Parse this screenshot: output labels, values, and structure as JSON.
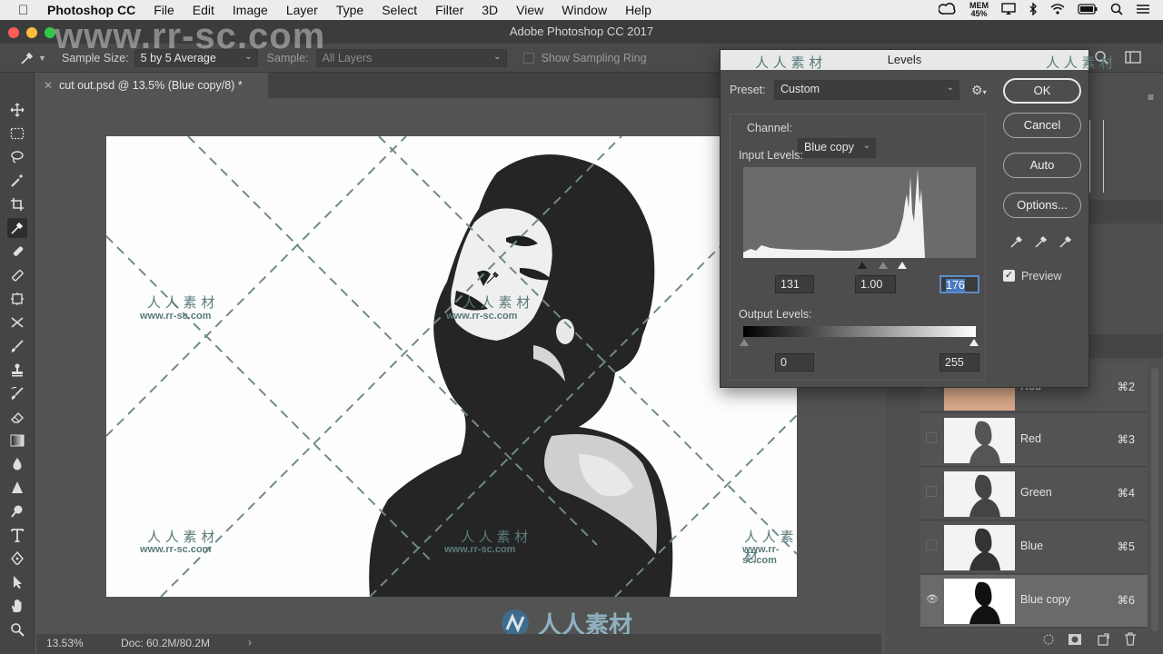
{
  "menubar": {
    "app_name": "Photoshop CC",
    "items": [
      "File",
      "Edit",
      "Image",
      "Layer",
      "Type",
      "Select",
      "Filter",
      "3D",
      "View",
      "Window",
      "Help"
    ],
    "mem_label": "MEM",
    "mem_value": "45%"
  },
  "window": {
    "title": "Adobe Photoshop CC 2017"
  },
  "options_bar": {
    "sample_size_label": "Sample Size:",
    "sample_size_value": "5 by 5 Average",
    "sample_label": "Sample:",
    "sample_value": "All Layers",
    "show_sampling_ring": "Show Sampling Ring"
  },
  "document": {
    "tab_title": "cut out.psd @ 13.5% (Blue copy/8) *"
  },
  "status": {
    "zoom": "13.53%",
    "doc_size": "Doc: 60.2M/80.2M"
  },
  "watermark": {
    "site": "www.rr-sc.com",
    "cn": "人 人 素 材",
    "big_cn": "人人素材"
  },
  "levels": {
    "title": "Levels",
    "preset_label": "Preset:",
    "preset_value": "Custom",
    "channel_label": "Channel:",
    "channel_value": "Blue copy",
    "input_levels_label": "Input Levels:",
    "input_black": "131",
    "input_gamma": "1.00",
    "input_white": "176",
    "output_levels_label": "Output Levels:",
    "output_black": "0",
    "output_white": "255",
    "buttons": {
      "ok": "OK",
      "cancel": "Cancel",
      "auto": "Auto",
      "options": "Options..."
    },
    "preview_label": "Preview"
  },
  "channels": [
    {
      "name": "Red",
      "shortcut": "⌘2",
      "visible": false
    },
    {
      "name": "Red",
      "shortcut": "⌘3",
      "visible": false
    },
    {
      "name": "Green",
      "shortcut": "⌘4",
      "visible": false
    },
    {
      "name": "Blue",
      "shortcut": "⌘5",
      "visible": false
    },
    {
      "name": "Blue copy",
      "shortcut": "⌘6",
      "visible": true
    }
  ]
}
